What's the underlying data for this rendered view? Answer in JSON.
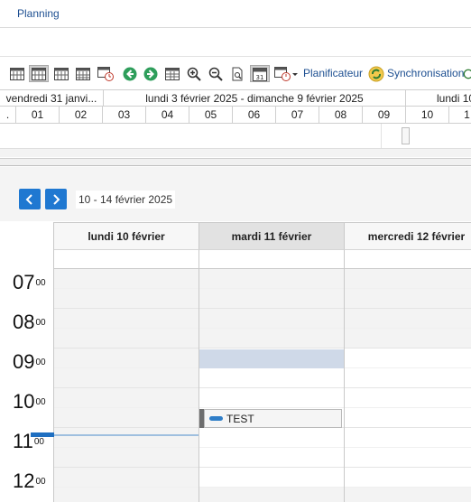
{
  "title": "Planning",
  "toolbar": {
    "planificateur": "Planificateur",
    "synchronisation": "Synchronisation"
  },
  "timeline": {
    "row1": [
      "vendredi 31 janvi...",
      "lundi 3 février 2025 - dimanche 9 février 2025",
      "lundi 10"
    ],
    "row2": [
      ".",
      "01",
      "02",
      "03",
      "04",
      "05",
      "06",
      "07",
      "08",
      "09",
      "10",
      "1"
    ]
  },
  "scheduler": {
    "range": "10 - 14 février 2025",
    "days": [
      "lundi 10 février",
      "mardi 11 février",
      "mercredi 12 février"
    ],
    "hours": [
      {
        "h": "07",
        "m": "00"
      },
      {
        "h": "08",
        "m": "00"
      },
      {
        "h": "09",
        "m": "00"
      },
      {
        "h": "10",
        "m": "00"
      },
      {
        "h": "11",
        "m": "00"
      },
      {
        "h": "12",
        "m": "00"
      }
    ],
    "event": {
      "label": "TEST"
    }
  },
  "colors": {
    "accent": "#1f78d1",
    "link": "#1d4f91",
    "selection": "#cfd9e8",
    "event_pill": "#2f7ec8"
  }
}
